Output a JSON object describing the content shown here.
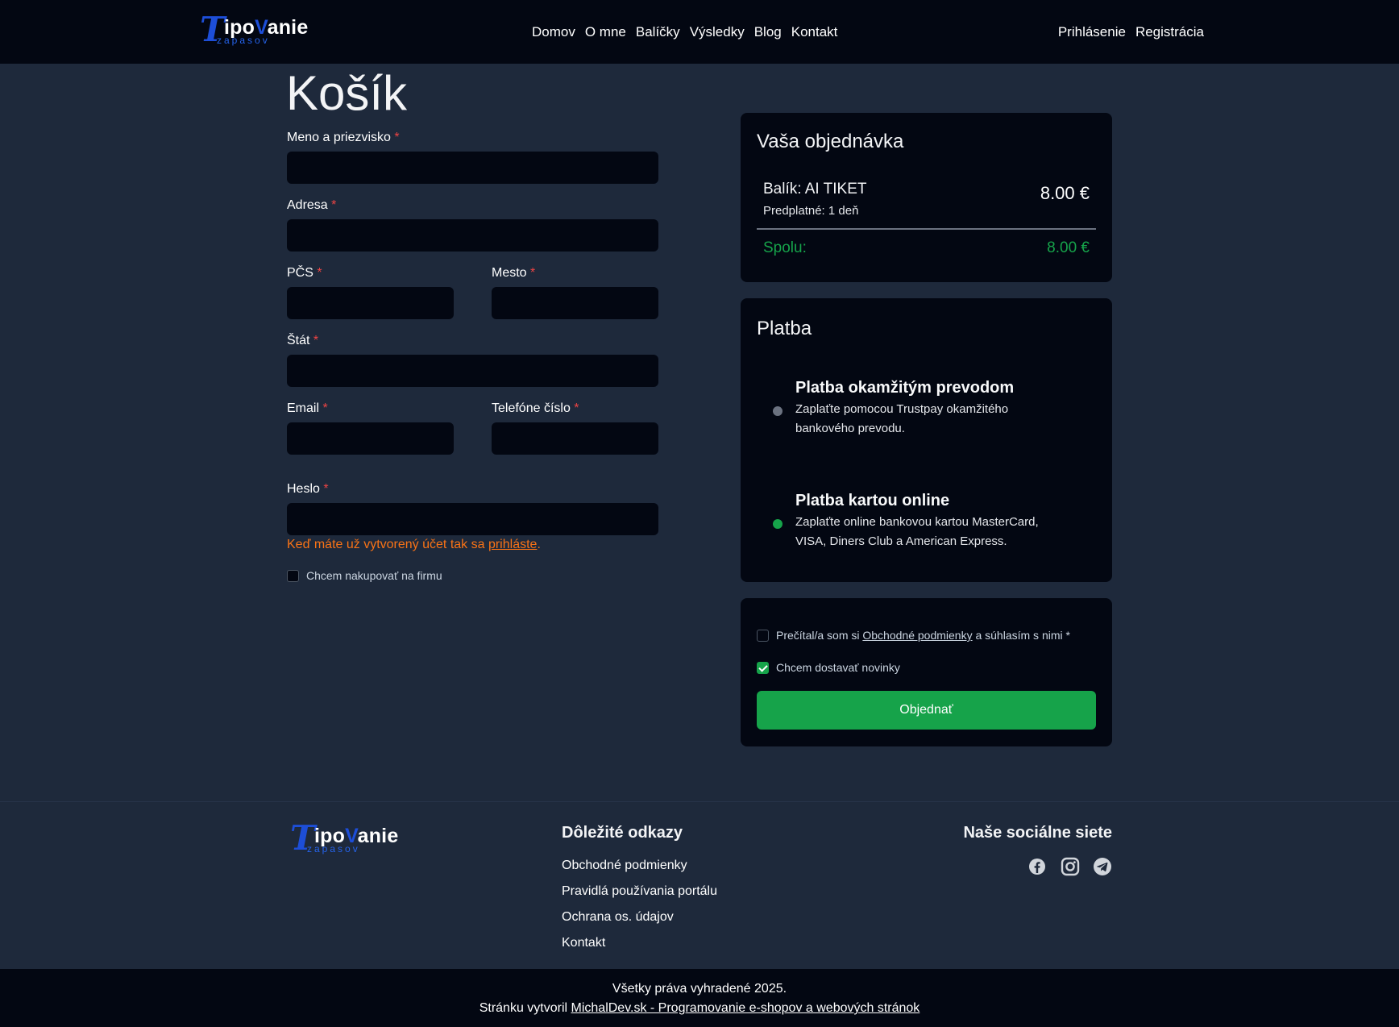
{
  "header": {
    "logo": {
      "t": "T",
      "word_pre": "ipo",
      "word_v": "V",
      "word_post": "anie",
      "sub": "zapasov"
    },
    "nav": [
      "Domov",
      "O mne",
      "Balíčky",
      "Výsledky",
      "Blog",
      "Kontakt"
    ],
    "auth": {
      "login": "Prihlásenie",
      "register": "Registrácia"
    }
  },
  "page": {
    "title": "Košík"
  },
  "form": {
    "name_label": "Meno a priezvisko",
    "address_label": "Adresa",
    "zip_label": "PČS",
    "city_label": "Mesto",
    "country_label": "Štát",
    "email_label": "Email",
    "phone_label": "Telefóne číslo",
    "password_label": "Heslo",
    "required_mark": "*",
    "login_hint_prefix": "Keď máte už vytvorený účet tak sa ",
    "login_hint_link": "prihláste",
    "login_hint_suffix": ".",
    "company_checkbox": "Chcem nakupovať na firmu"
  },
  "order": {
    "title": "Vaša objednávka",
    "item_name": "Balík: AI TIKET",
    "item_sub": "Predplatné: 1 deň",
    "item_price": "8.00 €",
    "total_label": "Spolu:",
    "total_value": "8.00 €"
  },
  "payment": {
    "title": "Platba",
    "options": [
      {
        "title": "Platba okamžitým prevodom",
        "desc": "Zaplaťte pomocou Trustpay okamžitého bankového prevodu.",
        "selected": false
      },
      {
        "title": "Platba kartou online",
        "desc": "Zaplaťte online bankovou kartou MasterCard, VISA, Diners Club a American Express.",
        "selected": true
      }
    ]
  },
  "confirm": {
    "terms_prefix": "Prečítal/a som si ",
    "terms_link": "Obchodné podmienky",
    "terms_suffix": " a súhlasím s nimi *",
    "newsletter": "Chcem dostavať novinky",
    "newsletter_checked": true,
    "terms_checked": false,
    "submit": "Objednať"
  },
  "footer": {
    "links_title": "Dôležité odkazy",
    "links": [
      "Obchodné podmienky",
      "Pravidlá používania portálu",
      "Ochrana os. údajov",
      "Kontakt"
    ],
    "social_title": "Naše sociálne siete",
    "social_icons": [
      "facebook-icon",
      "instagram-icon",
      "telegram-icon"
    ],
    "copyright": "Všetky práva vyhradené 2025.",
    "credit_prefix": "Stránku vytvoril ",
    "credit_link": "MichalDev.sk - Programovanie e-shopov a webových stránok"
  },
  "colors": {
    "header_bg": "#030712",
    "page_bg": "#1e293b",
    "accent_green": "#16a34a",
    "brand_blue": "#1d4ed8",
    "warning_orange": "#f97316",
    "required_red": "#ef4444"
  }
}
